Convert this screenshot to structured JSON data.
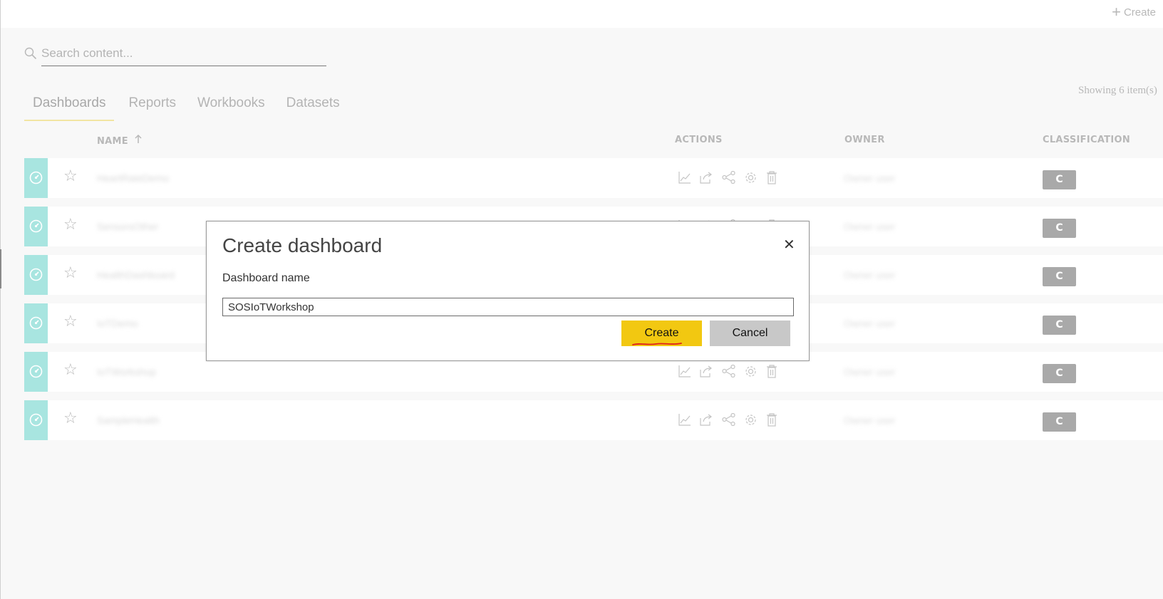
{
  "topbar": {
    "create_label": "Create"
  },
  "search": {
    "placeholder": "Search content..."
  },
  "showing_text": "Showing 6 item(s)",
  "tabs": [
    {
      "label": "Dashboards",
      "active": true
    },
    {
      "label": "Reports"
    },
    {
      "label": "Workbooks"
    },
    {
      "label": "Datasets"
    }
  ],
  "columns": {
    "name": "NAME",
    "actions": "ACTIONS",
    "owner": "OWNER",
    "classification": "CLASSIFICATION"
  },
  "rows": [
    {
      "name": "HeartRateDemo",
      "owner": "Owner user",
      "classification": "C"
    },
    {
      "name": "SensorsOther",
      "owner": "Owner user",
      "classification": "C"
    },
    {
      "name": "HealthDashboard",
      "owner": "Owner user",
      "classification": "C"
    },
    {
      "name": "IoTDemo",
      "owner": "Owner user",
      "classification": "C"
    },
    {
      "name": "IoTWorkshop",
      "owner": "Owner user",
      "classification": "C"
    },
    {
      "name": "SampleHealth",
      "owner": "Owner user",
      "classification": "C"
    }
  ],
  "dialog": {
    "title": "Create dashboard",
    "close_symbol": "✕",
    "field_label": "Dashboard name",
    "field_value": "SOSIoTWorkshop",
    "create_label": "Create",
    "cancel_label": "Cancel"
  },
  "colors": {
    "accent_yellow": "#f2c811",
    "tile_teal": "#a8e5e0",
    "badge_gray": "#a9a9a9",
    "annotation_red": "#e0201c"
  }
}
